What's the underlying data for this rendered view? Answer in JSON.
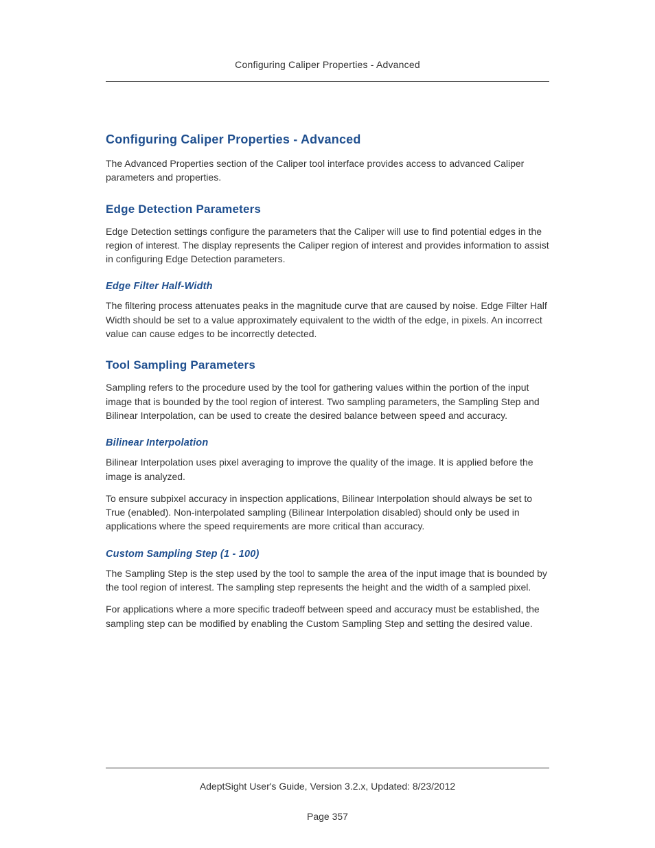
{
  "header": {
    "running_title": "Configuring Caliper Properties - Advanced"
  },
  "sections": {
    "title": "Configuring Caliper Properties - Advanced",
    "intro": "The Advanced Properties section of the Caliper tool interface provides access to advanced Caliper parameters and properties.",
    "edge_detection": {
      "heading": "Edge Detection Parameters",
      "para1": "Edge Detection settings configure the parameters that the Caliper will use to find potential edges in the region of interest. The display represents the Caliper region of interest and provides information to assist in configuring Edge Detection parameters.",
      "sub_edge_filter": {
        "heading": "Edge Filter Half-Width",
        "para1": "The filtering process attenuates peaks in the magnitude curve that are caused by noise. Edge Filter Half Width should be set to a value approximately equivalent to the width of the edge, in pixels. An incorrect value can cause edges to be incorrectly detected."
      }
    },
    "tool_sampling": {
      "heading": "Tool Sampling Parameters",
      "para1": "Sampling refers to the procedure used by the tool for gathering values within the portion of the input image that is bounded by the tool region of interest. Two sampling parameters, the Sampling Step and Bilinear Interpolation, can be used to create the desired balance between speed and accuracy.",
      "sub_bilinear": {
        "heading": "Bilinear Interpolation",
        "para1": "Bilinear Interpolation uses pixel averaging to improve the quality of the image. It is applied before the image is analyzed.",
        "para2": "To ensure subpixel accuracy in inspection applications, Bilinear Interpolation should always be set to True (enabled). Non-interpolated sampling (Bilinear Interpolation disabled) should only be used in applications where the speed requirements are more critical than accuracy."
      },
      "sub_custom_step": {
        "heading": "Custom Sampling Step (1 - 100)",
        "para1": "The Sampling Step is the step used by the tool to sample the area of the input image that is bounded by the tool region of interest. The sampling step represents the height and the width of a sampled pixel.",
        "para2": "For applications where a more specific tradeoff between speed and accuracy must be established, the sampling step can be modified by enabling the Custom Sampling Step and setting the desired value."
      }
    }
  },
  "footer": {
    "guide_line": "AdeptSight User's Guide,  Version 3.2.x, Updated: 8/23/2012",
    "page_label": "Page 357"
  }
}
